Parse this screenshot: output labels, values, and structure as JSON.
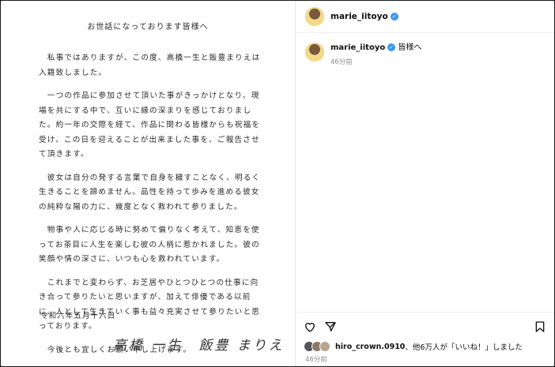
{
  "letter": {
    "title": "お世話になっております皆様へ",
    "paragraphs": [
      "　私事ではありますが、この度、高橋一生と飯豊まりえは入籍致しました。",
      "　一つの作品に参加させて頂いた事がきっかけとなり、現場を共にする中で、互いに縁の深まりを感じておりました。約一年の交際を経て、作品に関わる皆様からも祝福を受け、この日を迎えることが出来ました事を、ご報告させて頂きます。",
      "　彼女は自分の発する言葉で自身を穢すことなく、明るく生きることを諦めません。品性を持って歩みを進める彼女の純粋な陽の力に、幾度となく救われて参りました。",
      "　物事や人に応じる時に努めて偏りなく考えて、知恵を使ってお茶目に人生を楽しむ彼の人柄に惹かれました。彼の笑顔や情の深さに、いつも心を救われています。",
      "　これまでと変わらず、お芝居やひとつひとつの仕事に向き合って参りたいと思いますが、加えて俳優である以前に、人として生きていく事も益々充実させて参りたいと思っております。",
      "　今後とも宜しくお願い申し上げます。"
    ],
    "date": "令和六年五月十六日",
    "signature": "高橋 一生　飯豊 まりえ"
  },
  "header": {
    "username": "marie_iitoyo",
    "verified_glyph": "✓"
  },
  "caption": {
    "username": "marie_iitoyo",
    "text": "皆様へ",
    "time": "46分前"
  },
  "icons": {
    "like": "heart-icon",
    "share": "share-icon",
    "save": "bookmark-icon"
  },
  "likes": {
    "user": "hiro_crown.0910",
    "rest": "、他6万人が「いいね！」しました",
    "time": "46分前"
  },
  "colors": {
    "verified": "#3897f0",
    "muted": "#8e8e8e"
  }
}
